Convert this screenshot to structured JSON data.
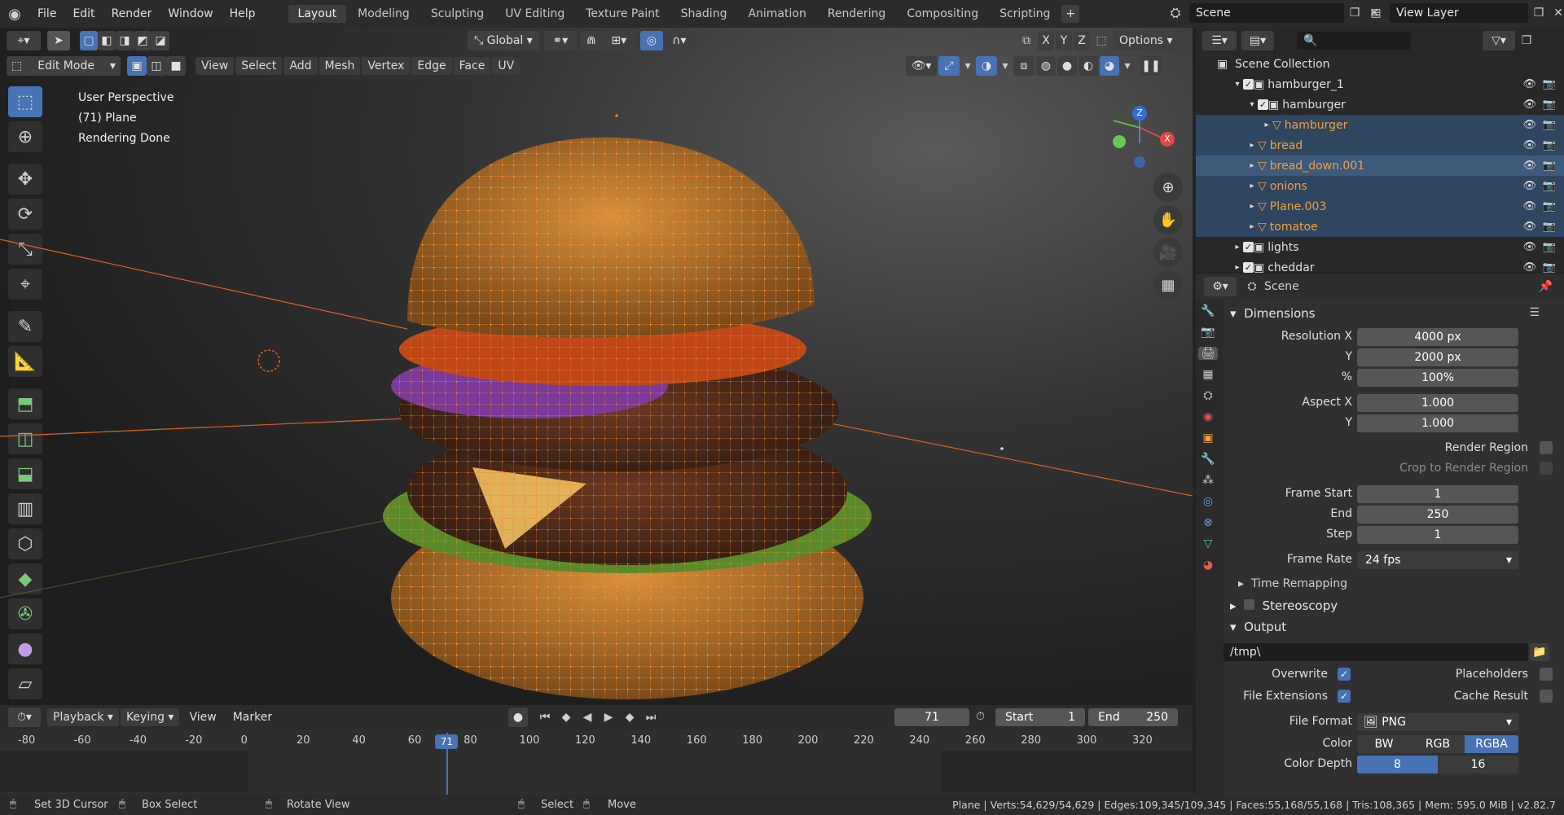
{
  "menu": [
    "File",
    "Edit",
    "Render",
    "Window",
    "Help"
  ],
  "workspaces": [
    "Layout",
    "Modeling",
    "Sculpting",
    "UV Editing",
    "Texture Paint",
    "Shading",
    "Animation",
    "Rendering",
    "Compositing",
    "Scripting"
  ],
  "active_workspace": "Layout",
  "add_tab": "+",
  "scene_name": "Scene",
  "view_layer": "View Layer",
  "header": {
    "transform_orientation": "Global",
    "axes": [
      "X",
      "Y",
      "Z"
    ],
    "options": "Options",
    "mode": "Edit Mode",
    "menus": [
      "View",
      "Select",
      "Add",
      "Mesh",
      "Vertex",
      "Edge",
      "Face",
      "UV"
    ]
  },
  "viewport_info": [
    "User Perspective",
    "(71) Plane",
    "Rendering Done"
  ],
  "gizmo": {
    "z": "Z",
    "x": "X"
  },
  "outliner": {
    "root": "Scene Collection",
    "rows": [
      {
        "name": "hamburger_1",
        "type": "collection",
        "depth": 1,
        "state": "normal"
      },
      {
        "name": "hamburger",
        "type": "collection",
        "depth": 2,
        "state": "normal"
      },
      {
        "name": "hamburger",
        "type": "mesh",
        "depth": 3,
        "state": "highlight"
      },
      {
        "name": "bread",
        "type": "mesh",
        "depth": 2,
        "state": "highlight"
      },
      {
        "name": "bread_down.001",
        "type": "mesh",
        "depth": 2,
        "state": "selected"
      },
      {
        "name": "onions",
        "type": "mesh",
        "depth": 2,
        "state": "highlight"
      },
      {
        "name": "Plane.003",
        "type": "mesh",
        "depth": 2,
        "state": "highlight"
      },
      {
        "name": "tomatoe",
        "type": "mesh",
        "depth": 2,
        "state": "highlight"
      },
      {
        "name": "lights",
        "type": "collection",
        "depth": 1,
        "state": "normal"
      },
      {
        "name": "cheddar",
        "type": "collection",
        "depth": 1,
        "state": "normal"
      }
    ]
  },
  "properties": {
    "context": "Scene",
    "dimensions": "Dimensions",
    "res_x_label": "Resolution X",
    "res_x": "4000 px",
    "res_y_label": "Y",
    "res_y": "2000 px",
    "pct_label": "%",
    "pct": "100%",
    "aspect_x_label": "Aspect X",
    "aspect_x": "1.000",
    "aspect_y_label": "Y",
    "aspect_y": "1.000",
    "render_region": "Render Region",
    "crop_region": "Crop to Render Region",
    "frame_start_label": "Frame Start",
    "frame_start": "1",
    "end_label": "End",
    "end": "250",
    "step_label": "Step",
    "step": "1",
    "frame_rate_label": "Frame Rate",
    "frame_rate": "24 fps",
    "time_remapping": "Time Remapping",
    "stereoscopy": "Stereoscopy",
    "output": "Output",
    "output_path": "/tmp\\",
    "overwrite": "Overwrite",
    "placeholders": "Placeholders",
    "file_extensions": "File Extensions",
    "cache_result": "Cache Result",
    "file_format_label": "File Format",
    "file_format": "PNG",
    "color_label": "Color",
    "color_modes": [
      "BW",
      "RGB",
      "RGBA"
    ],
    "active_color": "RGBA",
    "color_depth_label": "Color Depth",
    "color_depth": [
      "8",
      "16"
    ]
  },
  "timeline": {
    "menus": [
      "Playback",
      "Keying",
      "View",
      "Marker"
    ],
    "current_frame": "71",
    "start_label": "Start",
    "start": "1",
    "end_label": "End",
    "end": "250",
    "ticks": [
      "-80",
      "-60",
      "-40",
      "-20",
      "0",
      "20",
      "40",
      "60",
      "80",
      "100",
      "120",
      "140",
      "160",
      "180",
      "200",
      "220",
      "240",
      "260",
      "280",
      "300",
      "320"
    ]
  },
  "status": {
    "set_cursor": "Set 3D Cursor",
    "box_select": "Box Select",
    "rotate_view": "Rotate View",
    "select": "Select",
    "move": "Move",
    "stats": "Plane | Verts:54,629/54,629 | Edges:109,345/109,345 | Faces:55,168/55,168 | Tris:108,365 | Mem: 595.0 MiB | v2.82.7"
  },
  "colors": {
    "accent": "#4772b3",
    "selection": "#f0a040",
    "mesh_icon": "#f0a040"
  }
}
